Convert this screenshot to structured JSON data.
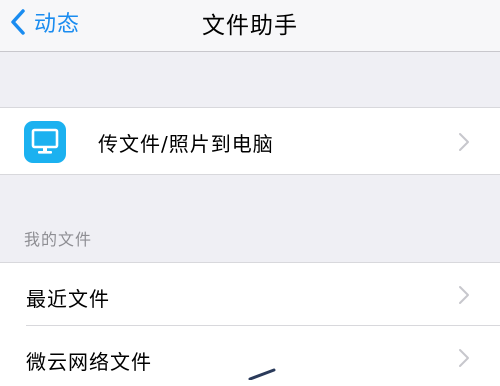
{
  "nav": {
    "back_label": "动态",
    "title": "文件助手"
  },
  "transfer": {
    "label": "传文件/照片到电脑",
    "icon": "monitor-icon"
  },
  "my_files": {
    "header": "我的文件",
    "items": [
      {
        "label": "最近文件"
      },
      {
        "label": "微云网络文件"
      }
    ]
  },
  "colors": {
    "accent": "#1a8cf0",
    "icon_bg": "#1bb1f0",
    "background": "#efeff4"
  }
}
